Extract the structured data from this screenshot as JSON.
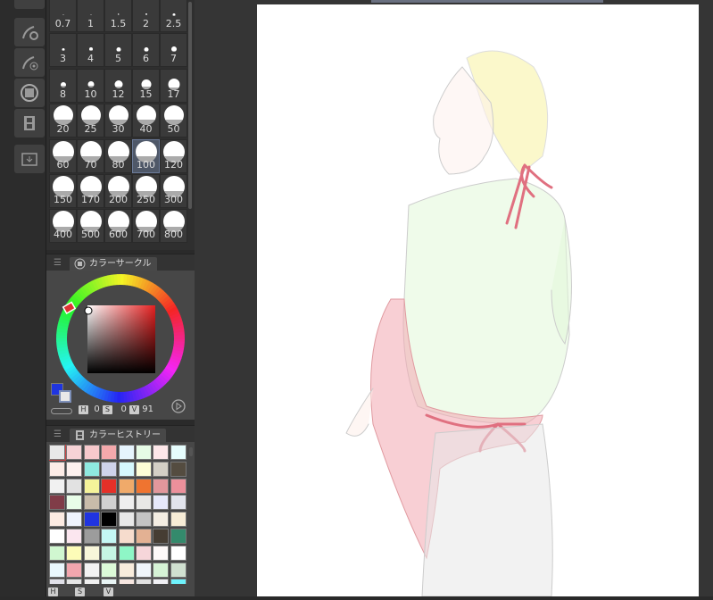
{
  "brush_sizes": [
    "0.7",
    "1",
    "1.5",
    "2",
    "2.5",
    "3",
    "4",
    "5",
    "6",
    "7",
    "8",
    "10",
    "12",
    "15",
    "17",
    "20",
    "25",
    "30",
    "40",
    "50",
    "60",
    "70",
    "80",
    "100",
    "120",
    "150",
    "170",
    "200",
    "250",
    "300",
    "400",
    "500",
    "600",
    "700",
    "800"
  ],
  "selected_brush_size": "100",
  "color_circle": {
    "title": "カラーサークル",
    "h_label": "H",
    "h": "0",
    "s_label": "S",
    "s": "0",
    "v_label": "V",
    "v": "91",
    "main_color": "#1f35e0",
    "sub_color": "#e8e8e8"
  },
  "color_history": {
    "title": "カラーヒストリー",
    "hsv_labels": [
      "H",
      "S",
      "V"
    ],
    "colors": [
      "#e8e8e8",
      "#f7d3d6",
      "#f7c9cc",
      "#f4a9ac",
      "#e6f4fd",
      "#e6fbe6",
      "#fde7e9",
      "#e6fdfd",
      "#fdece6",
      "#fdf1ee",
      "#8fe9e0",
      "#cfd3ea",
      "#d6f8fd",
      "#fdfdd6",
      "#d3cfc5",
      "#544c40",
      "#f1f1f1",
      "#e2e2e2",
      "#f5f39a",
      "#e53028",
      "#f0aa6a",
      "#ef7430",
      "#e2979c",
      "#ec909b",
      "#803c48",
      "#e8fde8",
      "#c8bcaa",
      "#d0d0d0",
      "#eeeeee",
      "#e8e8e6",
      "#e6e8fa",
      "#e2e4ec",
      "#fcebe3",
      "#eef3fd",
      "#2034e0",
      "#000000",
      "#e8e8e8",
      "#c4c4c4",
      "#f3ede3",
      "#f7ecd6",
      "#ffffff",
      "#fbe6ef",
      "#9c9c9c",
      "#c4f7f4",
      "#f6dccd",
      "#e3b193",
      "#463d33",
      "#348a6c",
      "#d0f7d0",
      "#fdfcb8",
      "#f8f6da",
      "#c6f6e4",
      "#8ef6c6",
      "#f6d6da",
      "#fef9f8",
      "#ffffff",
      "#eaf8fd",
      "#f2a6ae",
      "#f2f2f2",
      "#dcfad8",
      "#f8ecdc",
      "#f0f6fb",
      "#d6f3d6",
      "#d0e0d0",
      "#e0e0e8",
      "#e6e6e6",
      "#f0f0f0",
      "#e8f4f4",
      "#f6e6e0",
      "#e0e0e0",
      "#f0f0f4",
      "#6ef2fc"
    ]
  }
}
